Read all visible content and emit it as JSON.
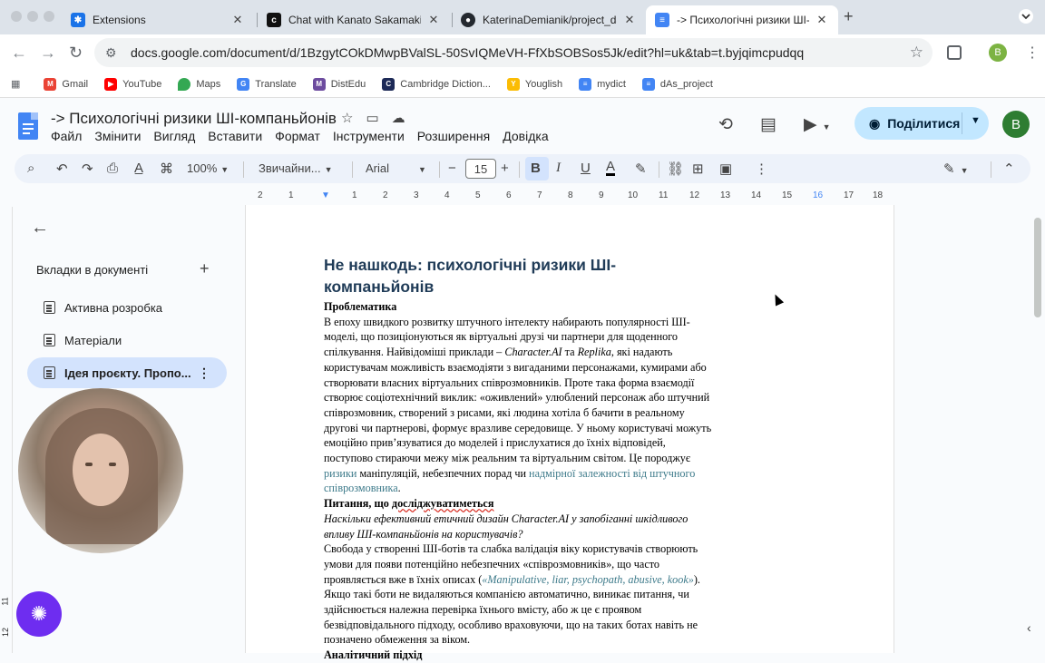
{
  "browser": {
    "tabs": [
      {
        "title": "Extensions",
        "favicon": "puzzle-icon"
      },
      {
        "title": "Chat with Kanato Sakamaki |",
        "favicon": "chat-icon"
      },
      {
        "title": "KaterinaDemianik/project_da",
        "favicon": "github-icon"
      },
      {
        "title": "-> Психологічні ризики ШІ-",
        "favicon": "docs-icon"
      }
    ],
    "url": "docs.google.com/document/d/1BzgytCOkDMwpBValSL-50SvIQMeVH-FfXbSOBSos5Jk/edit?hl=uk&tab=t.byjqimcpudqq",
    "profile_initial": "B",
    "bookmarks": [
      "Gmail",
      "YouTube",
      "Maps",
      "Translate",
      "DistEdu",
      "Cambridge Diction...",
      "Youglish",
      "mydict",
      "dAs_project"
    ]
  },
  "docs": {
    "title": "-> Психологічні ризики ШІ-компаньйонів",
    "menu": [
      "Файл",
      "Змінити",
      "Вигляд",
      "Вставити",
      "Формат",
      "Інструменти",
      "Розширення",
      "Довідка"
    ],
    "share_label": "Поділитися",
    "avatar_initial": "B",
    "toolbar": {
      "zoom": "100%",
      "style": "Звичайни...",
      "font": "Arial",
      "font_size": "15"
    },
    "ruler_ticks": [
      "2",
      "1",
      "1",
      "2",
      "3",
      "4",
      "5",
      "6",
      "7",
      "8",
      "9",
      "10",
      "11",
      "12",
      "13",
      "14",
      "15",
      "16",
      "17",
      "18"
    ],
    "vruler_ticks": [
      "11",
      "12"
    ]
  },
  "sidebar": {
    "heading": "Вкладки в документі",
    "items": [
      {
        "label": "Активна розробка"
      },
      {
        "label": "Матеріали"
      },
      {
        "label": "Ідея проєкту. Пропо..."
      }
    ]
  },
  "document": {
    "heading": "Не нашкодь: психологічні ризики ШІ-компаньйонів",
    "section1_title": "Проблематика",
    "p1_a": "В епоху швидкого розвитку штучного інтелекту набирають популярності ШІ-моделі, що позиціонуються як віртуальні друзі чи партнери для щоденного спілкування. Найвідоміші приклади – ",
    "p1_ex1": "Character.AI",
    "p1_and": " та ",
    "p1_ex2": "Replika",
    "p1_b": ", які надають користувачам можливість взаємодіяти з вигаданими персонажами, кумирами або створювати власних віртуальних співрозмовників. Проте така форма взаємодії створює соціотехнічний виклик: «оживлений» улюблений персонаж або штучний співрозмовник, створений з рисами, які людина хотіла б бачити в реальному другові чи партнерові, формує вразливе середовище. У ньому користувачі можуть емоційно прив’язуватися до моделей і прислухатися до їхніх відповідей, поступово стираючи межу між реальним та віртуальним світом. Це породжує ",
    "p1_link1": "ризики",
    "p1_c": " маніпуляцій, небезпечних порад чи ",
    "p1_link2": "надмірної залежності від штучного співрозмовника",
    "p1_end": ".",
    "section2_title_a": "Питання, що ",
    "section2_title_b": "досліджуватиметься",
    "question": "Наскільки ефективний етичний дизайн Character.AI у запобіганні шкідливого впливу ШІ-компаньйонів на користувачів?",
    "p2_a": "Свобода у створенні ШІ-ботів та слабка валідація віку користувачів створюють умови для появи потенційно небезпечних «співрозмовників», що часто проявляється вже в їхніх описах (",
    "p2_link": "«Manipulative, liar, psychopath, abusive, kook»",
    "p2_b": "). Якщо такі боти не видаляються компанією автоматично, виникає питання, чи здійснюється належна перевірка їхнього вмісту, або ж це є проявом безвідповідального підходу, особливо враховуючи, що на таких ботах навіть не позначено обмеження за віком.",
    "section3_title": "Аналітичний підхід"
  }
}
